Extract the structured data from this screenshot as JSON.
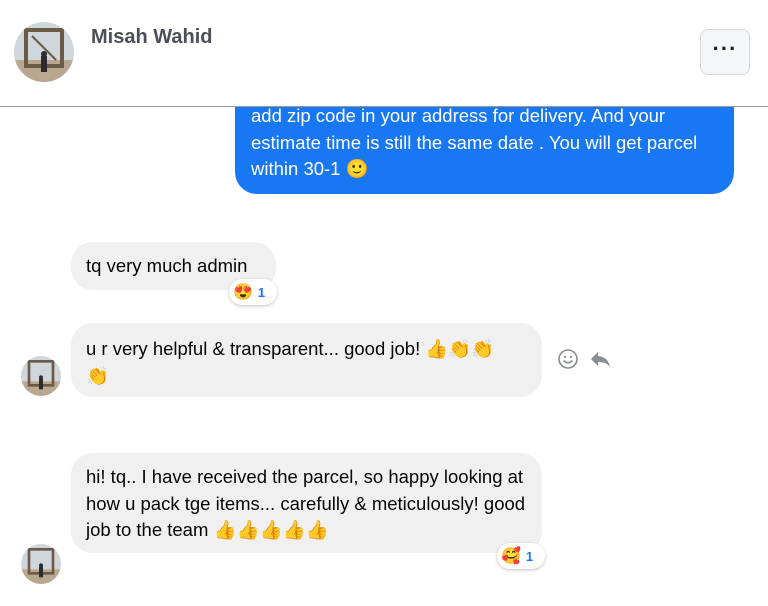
{
  "header": {
    "contact_name": "Misah Wahid",
    "more_label": "···"
  },
  "messages": [
    {
      "direction": "outgoing",
      "text": "add zip code in your address for delivery. And your estimate time is still the same date . You will get parcel within  30-1 🙂"
    },
    {
      "direction": "incoming",
      "text": "tq very much admin",
      "reaction": {
        "emoji": "😍",
        "count": "1"
      }
    },
    {
      "direction": "incoming",
      "text": "u r very helpful & transparent... good job! 👍👏👏\n👏"
    },
    {
      "direction": "incoming",
      "text": "hi! tq.. I have received the parcel, so happy looking at how u pack tge items... carefully & meticulously! good job to the team 👍👍👍👍👍",
      "reaction": {
        "emoji": "🥰",
        "count": "1"
      }
    }
  ],
  "icons": [
    "avatar-photo",
    "more-icon",
    "smiley-icon",
    "reply-icon"
  ],
  "colors": {
    "outgoing_bubble": "#1877f2",
    "incoming_bubble": "#f0f0f0",
    "reaction_count": "#1877f2",
    "header_divider": "#9a9a9a"
  }
}
